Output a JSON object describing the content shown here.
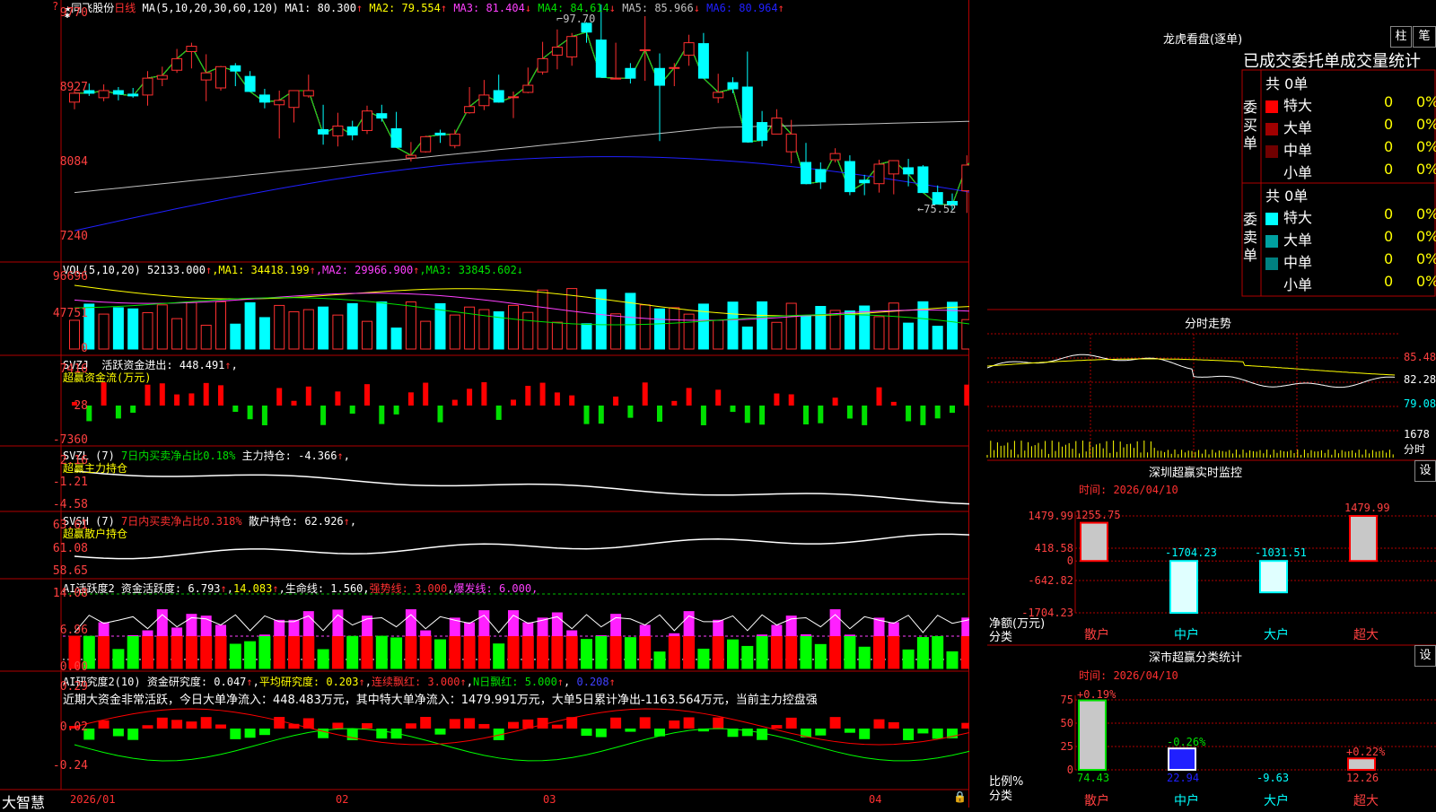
{
  "stock": {
    "name": "同飞股份",
    "period": "日线",
    "star": "★"
  },
  "main": {
    "ma_label": "MA(5,10,20,30,60,120)",
    "ma": [
      {
        "name": "MA1",
        "value": "80.300",
        "arrow": "↑",
        "color": "#ffffff"
      },
      {
        "name": "MA2",
        "value": "79.554",
        "arrow": "↑",
        "color": "#ffff00"
      },
      {
        "name": "MA3",
        "value": "81.404",
        "arrow": "↓",
        "color": "#ff40ff"
      },
      {
        "name": "MA4",
        "value": "84.614",
        "arrow": "↓",
        "color": "#00e000"
      },
      {
        "name": "MA5",
        "value": "85.966",
        "arrow": "↓",
        "color": "#c0c0c0"
      },
      {
        "name": "MA6",
        "value": "80.964",
        "arrow": "↑",
        "color": "#2020ff"
      }
    ],
    "y_labels": [
      "9770",
      "8927",
      "8084",
      "7240"
    ],
    "high_label": "97.70",
    "low_label": "75.52",
    "candles": [
      [
        87.7,
        89.2,
        86.9,
        88.7
      ],
      [
        89.0,
        89.8,
        88.4,
        88.7
      ],
      [
        88.2,
        89.7,
        87.8,
        89.0
      ],
      [
        89.0,
        89.4,
        87.9,
        88.6
      ],
      [
        88.6,
        89.3,
        88.2,
        88.4
      ],
      [
        88.5,
        91.2,
        87.3,
        90.4
      ],
      [
        90.3,
        91.7,
        89.5,
        90.7
      ],
      [
        91.3,
        93.7,
        91.0,
        92.6
      ],
      [
        93.4,
        94.4,
        91.5,
        94.0
      ],
      [
        90.2,
        93.1,
        87.8,
        91.0
      ],
      [
        89.3,
        91.5,
        89.0,
        91.7
      ],
      [
        91.8,
        92.1,
        89.5,
        91.2
      ],
      [
        90.6,
        91.2,
        90.0,
        88.9
      ],
      [
        88.5,
        89.2,
        87.0,
        87.7
      ],
      [
        87.4,
        89.0,
        83.6,
        87.9
      ],
      [
        87.1,
        88.8,
        85.4,
        89.0
      ],
      [
        88.4,
        90.8,
        88.2,
        89.0
      ],
      [
        84.6,
        87.4,
        82.9,
        84.1
      ],
      [
        83.9,
        86.5,
        82.7,
        85.0
      ],
      [
        84.9,
        85.6,
        83.4,
        84.0
      ],
      [
        84.5,
        87.3,
        84.1,
        86.7
      ],
      [
        86.4,
        87.4,
        85.5,
        85.9
      ],
      [
        84.7,
        86.6,
        84.3,
        82.6
      ],
      [
        81.4,
        83.2,
        81.0,
        81.7
      ],
      [
        82.1,
        83.9,
        82.0,
        83.8
      ],
      [
        84.2,
        84.6,
        83.1,
        84.0
      ],
      [
        82.8,
        84.6,
        82.5,
        84.1
      ],
      [
        86.5,
        89.4,
        86.4,
        87.2
      ],
      [
        87.3,
        90.2,
        86.8,
        88.5
      ],
      [
        89.0,
        90.8,
        88.1,
        87.7
      ],
      [
        88.3,
        88.9,
        85.9,
        88.3
      ],
      [
        88.8,
        91.6,
        88.7,
        89.6
      ],
      [
        91.1,
        94.5,
        90.8,
        92.6
      ],
      [
        93.0,
        95.9,
        91.4,
        93.9
      ],
      [
        92.8,
        95.5,
        91.8,
        95.1
      ],
      [
        96.6,
        96.7,
        94.4,
        95.6
      ],
      [
        94.7,
        98.7,
        93.5,
        90.5
      ],
      [
        90.4,
        94.4,
        90.3,
        90.4
      ],
      [
        91.5,
        92.1,
        89.8,
        90.4
      ],
      [
        93.5,
        97.4,
        90.1,
        93.6
      ],
      [
        91.5,
        93.2,
        83.3,
        89.6
      ],
      [
        91.6,
        92.1,
        89.5,
        91.6
      ],
      [
        93.0,
        95.3,
        91.8,
        94.4
      ],
      [
        94.3,
        95.5,
        92.8,
        90.4
      ],
      [
        88.2,
        90.9,
        87.6,
        88.8
      ],
      [
        89.9,
        90.5,
        88.7,
        89.2
      ],
      [
        89.4,
        93.4,
        87.7,
        83.2
      ],
      [
        85.4,
        86.7,
        82.7,
        83.4
      ],
      [
        84.1,
        86.9,
        84.1,
        85.9
      ],
      [
        82.1,
        85.7,
        80.8,
        84.1
      ],
      [
        80.9,
        83.1,
        78.5,
        78.5
      ],
      [
        80.1,
        80.9,
        77.9,
        78.7
      ],
      [
        81.2,
        82.5,
        80.9,
        81.9
      ],
      [
        81.0,
        81.7,
        77.2,
        77.6
      ],
      [
        78.9,
        79.5,
        77.2,
        78.6
      ],
      [
        78.5,
        81.2,
        77.5,
        80.7
      ],
      [
        79.6,
        80.3,
        77.3,
        81.1
      ],
      [
        80.3,
        81.3,
        78.2,
        79.6
      ],
      [
        80.4,
        80.6,
        77.7,
        77.5
      ],
      [
        77.5,
        78.3,
        76.2,
        76.2
      ],
      [
        76.5,
        77.4,
        75.5,
        76.1
      ],
      [
        77.7,
        81.7,
        75.2,
        80.6
      ],
      [
        79.6,
        81.4,
        78.6,
        81.8
      ],
      [
        82.6,
        86.5,
        82.0,
        84.2
      ]
    ]
  },
  "vol": {
    "label": "VOL(5,10,20)",
    "value": "52133.000",
    "arrow": "↑",
    "ma": [
      {
        "name": "MA1",
        "value": "34418.199",
        "arrow": "↑",
        "color": "#ffff00"
      },
      {
        "name": "MA2",
        "value": "29966.900",
        "arrow": "↑",
        "color": "#ff40ff"
      },
      {
        "name": "MA3",
        "value": "33845.602",
        "arrow": "↓",
        "color": "#00e000"
      }
    ],
    "y_labels": [
      "96696",
      "47751",
      "0"
    ]
  },
  "svzj": {
    "label": "SVZJ",
    "desc": "活跃资金进出:",
    "value": "448.491",
    "arrow": "↑",
    "sub": "超赢资金流(万元)",
    "y_labels": [
      "7416",
      "28",
      "-7360"
    ]
  },
  "svzl": {
    "label": "SVZL (7)",
    "desc": "7日内买卖净占比0.18%",
    "desc2": "主力持仓:",
    "value": "-4.366",
    "arrow": "↑",
    "sub": "超赢主力持仓",
    "y_labels": [
      "2.16",
      "-1.21",
      "-4.58"
    ]
  },
  "svsh": {
    "label": "SVSH (7)",
    "desc": "7日内买卖净占比0.318%",
    "desc2": "散户持仓:",
    "value": "62.926",
    "arrow": "↑",
    "sub": "超赢散户持仓",
    "y_labels": [
      "63.61",
      "61.08",
      "58.65"
    ]
  },
  "ai1": {
    "label": "AI活跃度2",
    "desc": "资金活跃度:",
    "v1": "6.793",
    "a1": "↑",
    "v2": "14.083",
    "desc3": "生命线:",
    "v3": "1.560",
    "desc4": "强势线:",
    "v4": "3.000",
    "desc5": "爆发线:",
    "v5": "6.000",
    "y_labels": [
      "14.08",
      "6.96",
      "0.00"
    ]
  },
  "ai2": {
    "label": "AI研究度2(10)",
    "desc": "资金研究度:",
    "v1": "0.047",
    "a1": "↑",
    "desc2": "平均研究度:",
    "v2": "0.203",
    "a2": "↑",
    "desc3": "连续飘红:",
    "v3": "3.000",
    "a3": "↑",
    "desc4": "N日飘红:",
    "v4": "5.000",
    "a4": "↑",
    "v5": "0.208",
    "a5": "↑",
    "note": "近期大资金非常活跃，今日大单净流入：448.483万元，其中特大单净流入：1479.991万元，大单5日累计净出-1163.564万元，当前主力控盘强",
    "y_labels": [
      "0.29",
      "0.02",
      "-0.24"
    ]
  },
  "xaxis": {
    "brand": "大智慧",
    "labels": [
      "2026/01",
      "02",
      "03",
      "04"
    ]
  },
  "right": {
    "lhb_title": "龙虎看盘(逐单)",
    "btn1": "柱",
    "btn2": "笔",
    "stats_title": "已成交委托单成交量统计",
    "buy_group": "委买单",
    "sell_group": "委卖单",
    "buy_total": "共 0单",
    "sell_total": "共 0单",
    "rows": [
      {
        "label": "特大",
        "qty": "0",
        "pct": "0%"
      },
      {
        "label": "大单",
        "qty": "0",
        "pct": "0%"
      },
      {
        "label": "中单",
        "qty": "0",
        "pct": "0%"
      },
      {
        "label": "小单",
        "qty": "0",
        "pct": "0%"
      }
    ],
    "buy_colors": [
      "#ff0000",
      "#a00000",
      "#700000",
      "#000000"
    ],
    "sell_colors": [
      "#00ffff",
      "#00a0a0",
      "#008080",
      "#000000"
    ],
    "intraday_title": "分时走势",
    "intraday_y": [
      "85.48",
      "82.28",
      "79.08",
      "1678"
    ],
    "intraday_unit": "分时",
    "sz_title": "深圳超赢实时监控",
    "set_label": "设",
    "date": "时间: 2026/04/10",
    "sz_y": [
      "1479.99",
      "418.58",
      "0",
      "-642.82",
      "-1704.23"
    ],
    "sz_yunit": "净额(万元)",
    "sz_xunit": "分类",
    "sz_bars": [
      {
        "cat": "散户",
        "val": "1255.75"
      },
      {
        "cat": "中户",
        "val": "-1704.23"
      },
      {
        "cat": "大户",
        "val": "-1031.51"
      },
      {
        "cat": "超大",
        "val": "1479.99"
      }
    ],
    "sc_title": "深市超赢分类统计",
    "sc_y": [
      "75",
      "50",
      "25",
      "0"
    ],
    "sc_yunit": "比例%",
    "sc_xunit": "分类",
    "sc_bars": [
      {
        "cat": "散户",
        "pct": "+0.19%",
        "val": "74.43"
      },
      {
        "cat": "中户",
        "pct": "-0.26%",
        "val": "22.94"
      },
      {
        "cat": "大户",
        "pct": "",
        "val": "-9.63"
      },
      {
        "cat": "超大",
        "pct": "+0.22%",
        "val": "12.26"
      }
    ]
  }
}
